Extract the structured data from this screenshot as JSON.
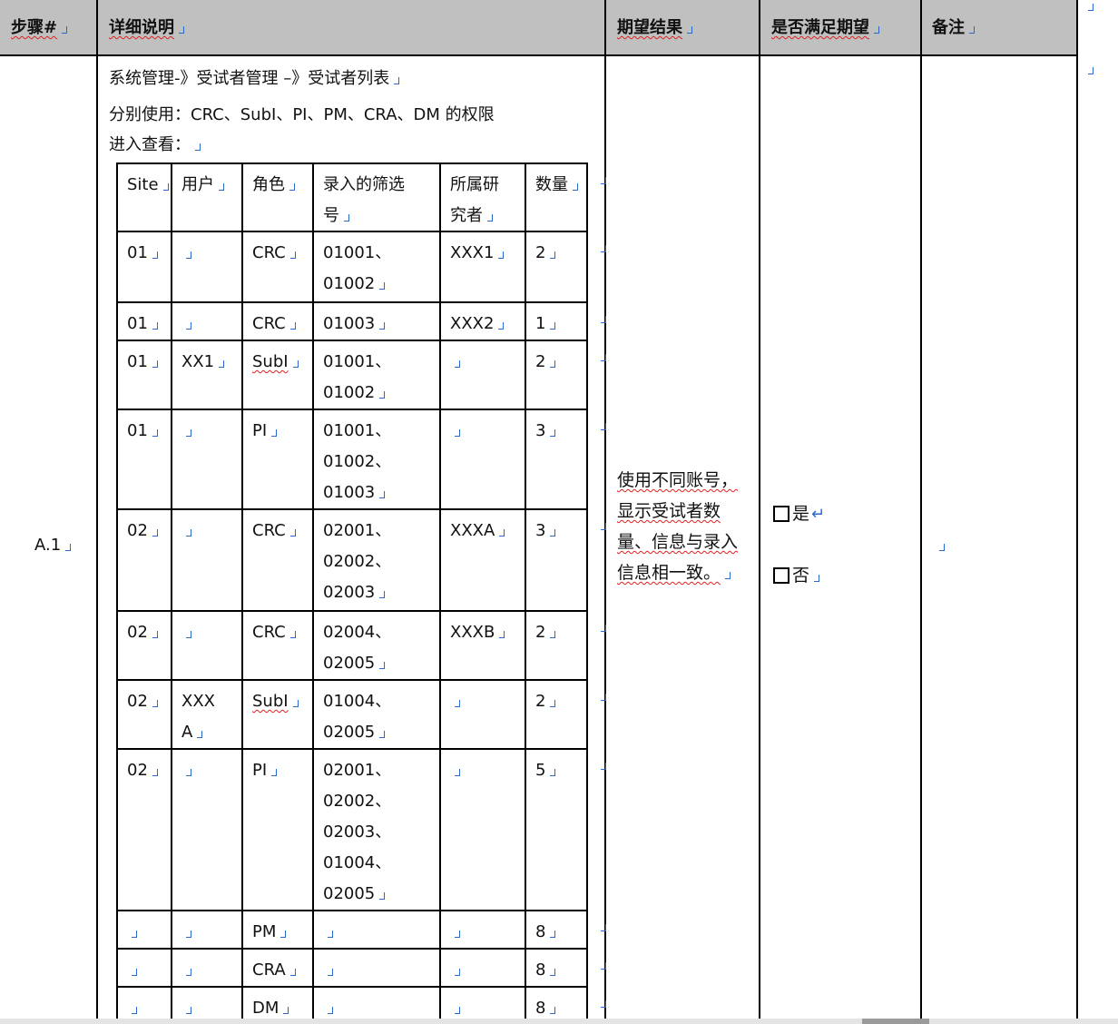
{
  "header": {
    "step": "步骤#",
    "description": "详细说明",
    "expected": "期望结果",
    "met": "是否满足期望",
    "notes": "备注"
  },
  "step_id": "A.1",
  "description": {
    "line1": "系统管理-》受试者管理 –》受试者列表",
    "line2": "分别使用：CRC、SubI、PI、PM、CRA、DM 的权限",
    "line3": "进入查看："
  },
  "inner_table": {
    "headers": [
      "Site",
      "用户",
      "角色",
      "录入的筛选\n号",
      "所属研\n究者",
      "数量"
    ],
    "rows": [
      [
        "01",
        "",
        "CRC",
        "01001、\n01002",
        "XXX1",
        "2"
      ],
      [
        "01",
        "",
        "CRC",
        "01003",
        "XXX2",
        "1"
      ],
      [
        "01",
        "XX1",
        "SubI",
        "01001、\n01002",
        "",
        "2"
      ],
      [
        "01",
        "",
        "PI",
        "01001、\n01002、\n01003",
        "",
        "3"
      ],
      [
        "02",
        "",
        "CRC",
        "02001、\n02002、\n02003",
        "XXXA",
        "3"
      ],
      [
        "02",
        "",
        "CRC",
        "02004、\n02005",
        "XXXB",
        "2"
      ],
      [
        "02",
        "XXX\nA",
        "SubI",
        "01004、\n02005",
        "",
        "2"
      ],
      [
        "02",
        "",
        "PI",
        "02001、\n02002、\n02003、\n01004、\n02005",
        "",
        "5"
      ],
      [
        "",
        "",
        "PM",
        "",
        "",
        "8"
      ],
      [
        "",
        "",
        "CRA",
        "",
        "",
        "8"
      ],
      [
        "",
        "",
        "DM",
        "",
        "",
        "8"
      ]
    ]
  },
  "expected_result": "使用不同账号，显示受试者数量、信息与录入信息相一致。",
  "options": {
    "yes": "是",
    "no": "否"
  },
  "notes_value": ""
}
